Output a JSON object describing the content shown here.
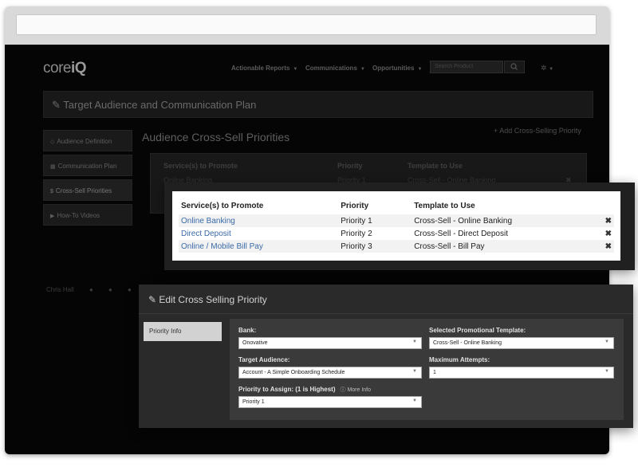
{
  "app": {
    "logo": {
      "prefix": "core",
      "suffix": "iQ"
    },
    "nav": {
      "items": [
        "Actionable Reports",
        "Communications",
        "Opportunities"
      ],
      "search_placeholder": "Search Product",
      "search_icon": "search-icon",
      "gear_icon": "gear-icon"
    },
    "page_title": "Target Audience and Communication Plan",
    "sidebar": [
      {
        "label": "Audience Definition",
        "icon": "◇"
      },
      {
        "label": "Communication Plan",
        "icon": "▦"
      },
      {
        "label": "Cross-Sell Priorities",
        "icon": "$"
      },
      {
        "label": "How-To Videos",
        "icon": "▶"
      }
    ],
    "main_title": "Audience Cross-Sell Priorities",
    "add_link": "+ Add Cross-Selling Priority",
    "footer": {
      "user": "Chris Hall"
    }
  },
  "table": {
    "columns": [
      "Service(s) to Promote",
      "Priority",
      "Template to Use"
    ],
    "rows": [
      {
        "service": "Online Banking",
        "priority": "Priority 1",
        "template": "Cross-Sell - Online Banking"
      },
      {
        "service": "Direct Deposit",
        "priority": "Priority 2",
        "template": "Cross-Sell - Direct Deposit"
      },
      {
        "service": "Online / Mobile Bill Pay",
        "priority": "Priority 3",
        "template": "Cross-Sell - Bill Pay"
      }
    ],
    "delete_glyph": "✖"
  },
  "edit": {
    "title": "Edit Cross Selling Priority",
    "tab": "Priority Info",
    "fields": {
      "bank": {
        "label": "Bank:",
        "value": "Onovative"
      },
      "template": {
        "label": "Selected Promotional Template:",
        "value": "Cross-Sell - Online Banking"
      },
      "audience": {
        "label": "Target Audience:",
        "value": "Account - A Simple Onboarding Schedule"
      },
      "attempts": {
        "label": "Maximum Attempts:",
        "value": "1"
      },
      "priority": {
        "label": "Priority to Assign: (1 is Highest)",
        "more": "More Info",
        "value": "Priority 1"
      }
    }
  },
  "colors": {
    "link": "#3a6aa7",
    "panel": "#2a2a2a",
    "form": "#3a3a3a"
  }
}
